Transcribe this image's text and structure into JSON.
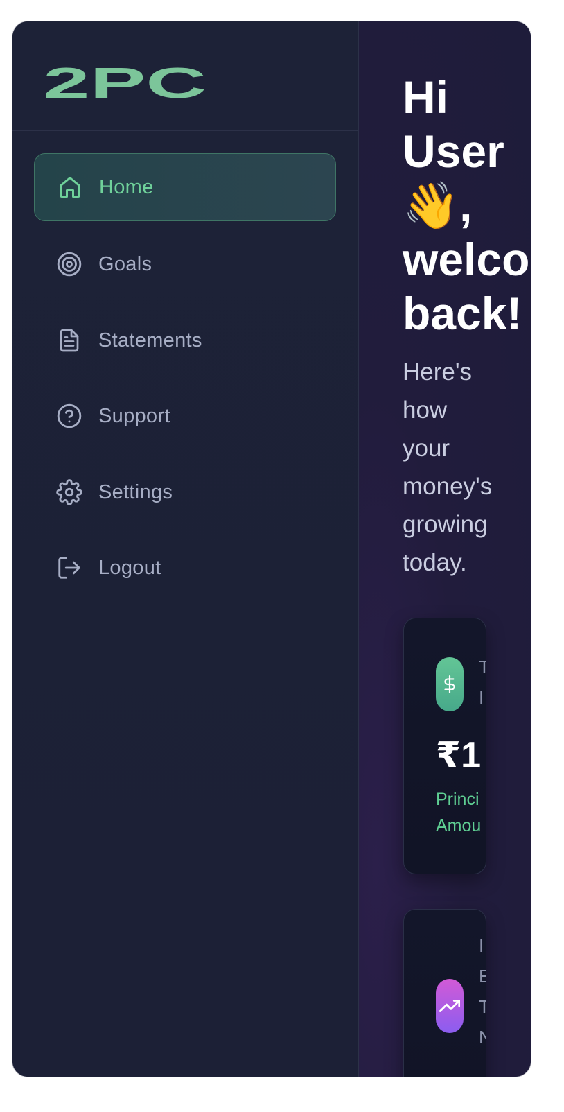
{
  "brand": {
    "logo_text": "2PC",
    "accent": "#7cc59a"
  },
  "sidebar": {
    "items": [
      {
        "label": "Home",
        "icon": "home-icon",
        "active": true
      },
      {
        "label": "Goals",
        "icon": "target-icon",
        "active": false
      },
      {
        "label": "Statements",
        "icon": "document-icon",
        "active": false
      },
      {
        "label": "Support",
        "icon": "help-circle-icon",
        "active": false
      },
      {
        "label": "Settings",
        "icon": "gear-icon",
        "active": false
      },
      {
        "label": "Logout",
        "icon": "logout-icon",
        "active": false
      }
    ]
  },
  "main": {
    "greeting": {
      "line1": "Hi",
      "line2": "User",
      "line3": "👋,",
      "line4": "welco",
      "line5": "back!"
    },
    "subtitle": {
      "line1": "Here's",
      "line2": "how",
      "line3": "your",
      "line4": "money's",
      "line5": "growing",
      "line6": "today."
    },
    "cards": [
      {
        "icon": "dollar-icon",
        "side_label_1": "T",
        "side_label_2": "I",
        "amount": "₹1",
        "sub_label_1": "Princi",
        "sub_label_2": "Amou"
      },
      {
        "icon": "trending-up-icon",
        "side_label_1": "I",
        "side_label_2": "E",
        "side_label_3": "T",
        "side_label_4": "N"
      }
    ]
  },
  "colors": {
    "sidebar_bg": "#1d2237",
    "main_bg": "#211c3c",
    "active_text": "#6fd19a",
    "inactive_text": "#a7aec5",
    "card_green": "#55b78f",
    "card_purple": "#b95ee0"
  }
}
